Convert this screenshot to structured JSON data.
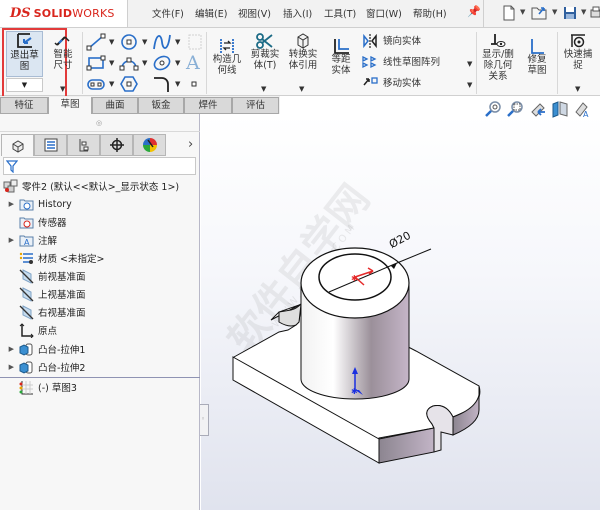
{
  "app": {
    "brand_prefix": "DS",
    "brand_name_bold": "SOLID",
    "brand_name_light": "WORKS"
  },
  "menu": [
    {
      "label": "文件(F)"
    },
    {
      "label": "编辑(E)"
    },
    {
      "label": "视图(V)"
    },
    {
      "label": "插入(I)"
    },
    {
      "label": "工具(T)"
    },
    {
      "label": "窗口(W)"
    },
    {
      "label": "帮助(H)"
    }
  ],
  "quick_access": {
    "pin": "pin-icon",
    "items": [
      "new-document-icon",
      "open-icon",
      "save-icon",
      "print-icon"
    ]
  },
  "ribbon": {
    "exit_sketch": "退出草图",
    "smart_dimension": "智能尺寸",
    "construction_geometry": "构造几何线",
    "trim_entities": "剪裁实体(T)",
    "convert_entities": "转换实体引用",
    "offset_entities": "等距实体",
    "mirror_entities": "镜向实体",
    "linear_pattern": "线性草图阵列",
    "move_entities": "移动实体",
    "display_delete_relations": "显示/删除几何关系",
    "repair_sketch": "修复草图",
    "quick_snaps": "快速捕捉"
  },
  "tabs": [
    {
      "label": "特征",
      "active": false
    },
    {
      "label": "草图",
      "active": true
    },
    {
      "label": "曲面",
      "active": false
    },
    {
      "label": "钣金",
      "active": false
    },
    {
      "label": "焊件",
      "active": false
    },
    {
      "label": "评估",
      "active": false
    }
  ],
  "panel_tabs": [
    "featuremanager-icon",
    "propertymanager-icon",
    "configurationmanager-icon",
    "dimxpert-icon",
    "display-manager-icon"
  ],
  "panel_more": "›",
  "tree": {
    "root": "零件2 (默认<<默认>_显示状态 1>)",
    "items": [
      {
        "label": "History",
        "expandable": true,
        "icon": "history-folder-icon"
      },
      {
        "label": "传感器",
        "expandable": false,
        "icon": "sensors-folder-icon"
      },
      {
        "label": "注解",
        "expandable": true,
        "icon": "annotations-folder-icon"
      },
      {
        "label": "材质 <未指定>",
        "expandable": false,
        "icon": "material-icon"
      },
      {
        "label": "前视基准面",
        "expandable": false,
        "icon": "plane-icon"
      },
      {
        "label": "上视基准面",
        "expandable": false,
        "icon": "plane-icon"
      },
      {
        "label": "右视基准面",
        "expandable": false,
        "icon": "plane-icon"
      },
      {
        "label": "原点",
        "expandable": false,
        "icon": "origin-icon"
      },
      {
        "label": "凸台-拉伸1",
        "expandable": true,
        "icon": "extrude-icon"
      },
      {
        "label": "凸台-拉伸2",
        "expandable": true,
        "icon": "extrude-icon"
      },
      {
        "label": "(-) 草图3",
        "expandable": false,
        "icon": "sketch-icon"
      }
    ]
  },
  "viewport": {
    "dimension_label": "Ø20",
    "watermark_cn": "软件自学网",
    "watermark_url": "WWW.RJZXW.COM",
    "hud": [
      "zoom-to-fit-icon",
      "zoom-to-area-icon",
      "previous-view-icon",
      "section-view-icon",
      "view-orientation-icon"
    ]
  }
}
